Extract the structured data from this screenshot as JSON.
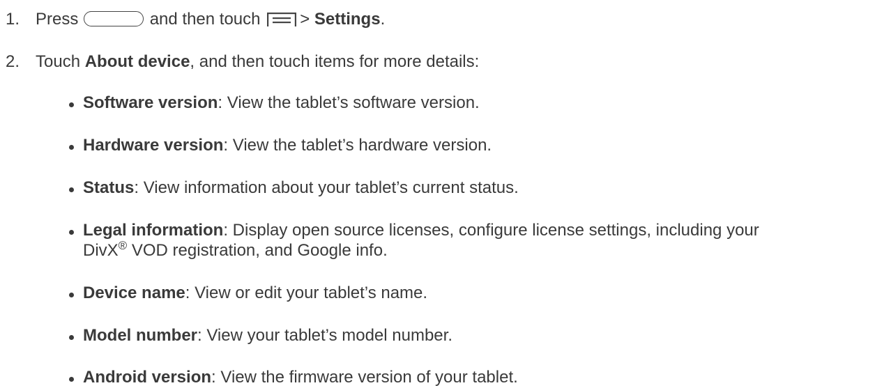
{
  "steps": [
    {
      "number": "1.",
      "press": "Press",
      "home_icon": "home-key-icon",
      "middle": "and then touch",
      "menu_icon": "menu-icon",
      "sep": ">",
      "target": "Settings",
      "end": "."
    },
    {
      "number": "2.",
      "touch": "Touch",
      "target": "About device",
      "rest": ", and then touch items for more details:"
    }
  ],
  "items": [
    {
      "term": "Software version",
      "desc": ": View the tablet’s software version."
    },
    {
      "term": "Hardware version",
      "desc": ": View the tablet’s hardware version."
    },
    {
      "term": "Status",
      "desc": ": View information about your tablet’s current status."
    },
    {
      "term": "Legal information",
      "desc": ": Display open source licenses, configure license settings, including your",
      "desc2_pre": "DivX",
      "desc2_sup": "®",
      "desc2_post": " VOD registration, and Google info."
    },
    {
      "term": "Device name",
      "desc": ": View or edit your tablet’s name."
    },
    {
      "term": "Model number",
      "desc": ": View your tablet’s model number."
    },
    {
      "term": "Android version",
      "desc": ": View the firmware version of your tablet."
    }
  ]
}
